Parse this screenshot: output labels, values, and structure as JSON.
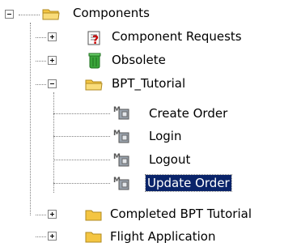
{
  "tree": {
    "root": {
      "label": "Components",
      "icon": "folder-open-icon",
      "expanded": true
    },
    "children": [
      {
        "label": "Component Requests",
        "icon": "component-request-icon",
        "expanded": false
      },
      {
        "label": "Obsolete",
        "icon": "trash-can-icon",
        "expanded": false
      },
      {
        "label": "BPT_Tutorial",
        "icon": "folder-open-icon",
        "expanded": true,
        "children": [
          {
            "label": "Create Order",
            "icon": "business-component-icon"
          },
          {
            "label": "Login",
            "icon": "business-component-icon"
          },
          {
            "label": "Logout",
            "icon": "business-component-icon"
          },
          {
            "label": "Update Order",
            "icon": "business-component-icon",
            "selected": true
          }
        ]
      },
      {
        "label": "Completed BPT Tutorial",
        "icon": "folder-icon",
        "expanded": false
      },
      {
        "label": "Flight Application",
        "icon": "folder-icon",
        "expanded": false
      }
    ]
  },
  "colors": {
    "selection": "#0a246a",
    "folder": "#f4c542",
    "trash": "#3aa53a"
  }
}
